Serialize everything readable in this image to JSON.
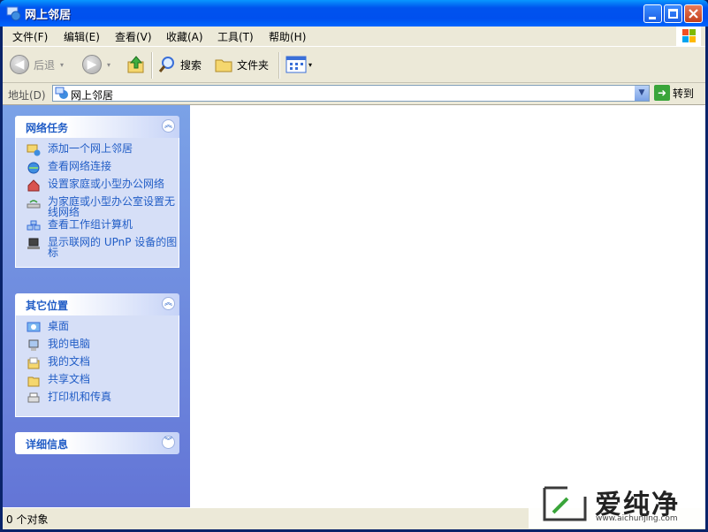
{
  "window": {
    "title": "网上邻居"
  },
  "menu": [
    {
      "label": "文件(F)"
    },
    {
      "label": "编辑(E)"
    },
    {
      "label": "查看(V)"
    },
    {
      "label": "收藏(A)"
    },
    {
      "label": "工具(T)"
    },
    {
      "label": "帮助(H)"
    }
  ],
  "toolbar": {
    "back": "后退",
    "search": "搜索",
    "folders": "文件夹"
  },
  "address": {
    "label": "地址(D)",
    "value": "网上邻居",
    "go": "转到"
  },
  "panels": {
    "network_tasks": {
      "title": "网络任务",
      "items": [
        "添加一个网上邻居",
        "查看网络连接",
        "设置家庭或小型办公网络",
        "为家庭或小型办公室设置无线网络",
        "查看工作组计算机",
        "显示联网的 UPnP 设备的图标"
      ]
    },
    "other_places": {
      "title": "其它位置",
      "items": [
        "桌面",
        "我的电脑",
        "我的文档",
        "共享文档",
        "打印机和传真"
      ]
    },
    "details": {
      "title": "详细信息"
    }
  },
  "status": {
    "text": "0 个对象"
  },
  "watermark": {
    "brand": "爱纯净",
    "url": "www.aichunjing.com"
  }
}
